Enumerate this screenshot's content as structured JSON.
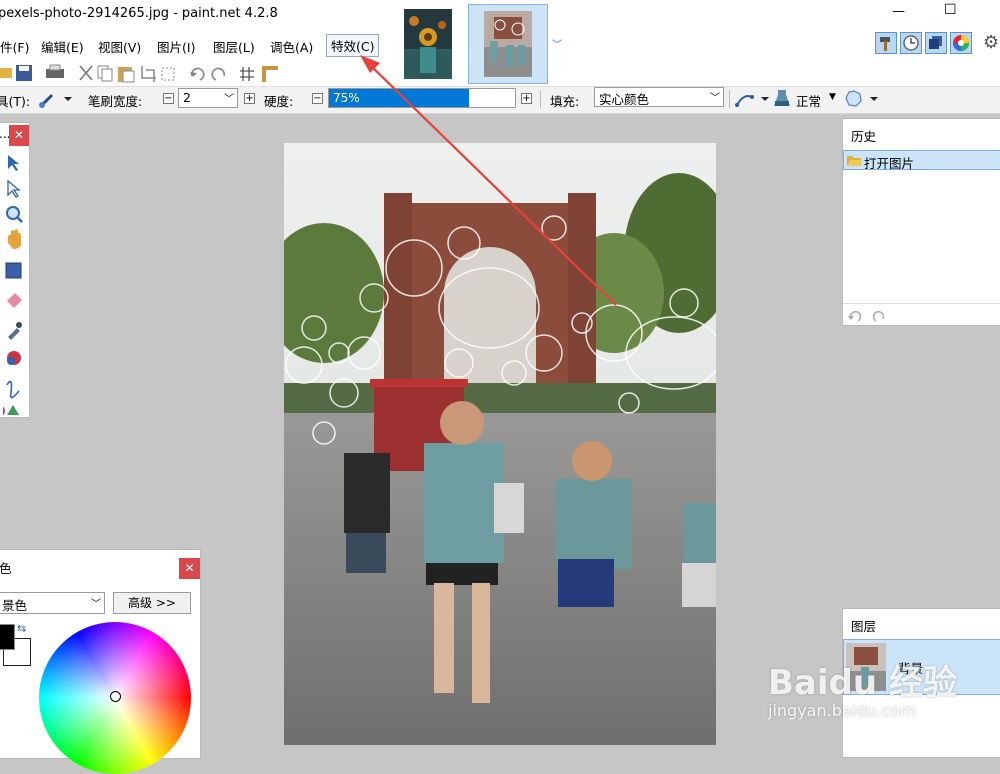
{
  "window": {
    "title": "pexels-photo-2914265.jpg - paint.net 4.2.8",
    "controls": {
      "minimize": "—",
      "maximize": "☐",
      "close": "✕"
    }
  },
  "menu": {
    "items": [
      "件(F)",
      "编辑(E)",
      "视图(V)",
      "图片(I)",
      "图层(L)",
      "调色(A)",
      "特效(C)"
    ]
  },
  "toolbar2": {
    "tool_label": "具(T):",
    "brush_width_label": "笔刷宽度:",
    "brush_width_value": "2",
    "hardness_label": "硬度:",
    "hardness_value": "75%",
    "hardness_level": 0.75,
    "fill_label": "填充:",
    "fill_value": "实心颜色",
    "blend_mode": "正常"
  },
  "history_panel": {
    "title": "历史",
    "items": [
      "打开图片"
    ]
  },
  "layers_panel": {
    "title": "图层",
    "items": [
      "背景"
    ]
  },
  "colors_panel": {
    "title": "色",
    "select_value": "景色",
    "advanced_button": "高级 >>"
  },
  "tools_panel": {
    "title": "..."
  },
  "close_symbol": "✕",
  "watermark": {
    "line1": "Baidu 经验",
    "line2": "jingyan.baidu.com"
  },
  "colors": {
    "accent": "#0078d7",
    "selection_bg": "#cce4f7",
    "close_red": "#d9484a",
    "annotation_arrow": "#e8403a"
  }
}
